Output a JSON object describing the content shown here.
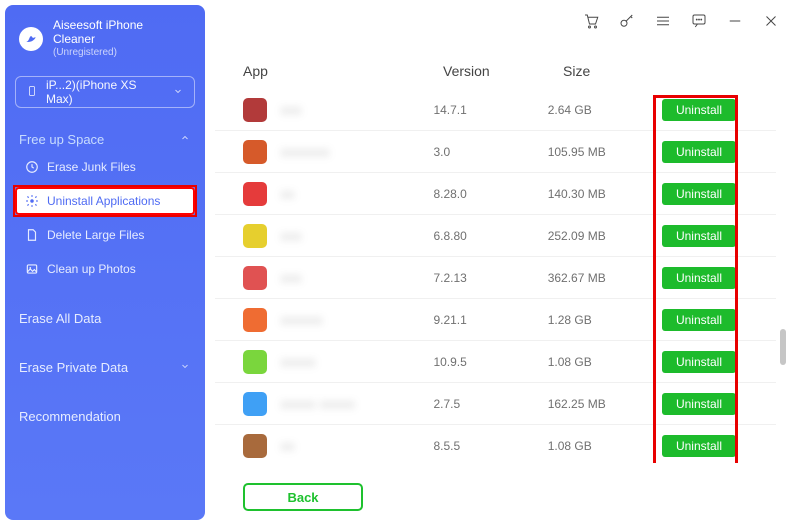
{
  "brand": {
    "name": "Aiseesoft iPhone",
    "sub": "Cleaner",
    "status": "(Unregistered)"
  },
  "device": {
    "label": "iP...2)(iPhone XS Max)"
  },
  "sidebar": {
    "free_up_space": "Free up Space",
    "items": [
      {
        "label": "Erase Junk Files"
      },
      {
        "label": "Uninstall Applications"
      },
      {
        "label": "Delete Large Files"
      },
      {
        "label": "Clean up Photos"
      }
    ],
    "erase_all": "Erase All Data",
    "erase_private": "Erase Private Data",
    "recommendation": "Recommendation"
  },
  "columns": {
    "app": "App",
    "version": "Version",
    "size": "Size"
  },
  "actions": {
    "uninstall": "Uninstall",
    "back": "Back"
  },
  "apps": [
    {
      "version": "14.7.1",
      "size": "2.64 GB"
    },
    {
      "version": "3.0",
      "size": "105.95 MB"
    },
    {
      "version": "8.28.0",
      "size": "140.30 MB"
    },
    {
      "version": "6.8.80",
      "size": "252.09 MB"
    },
    {
      "version": "7.2.13",
      "size": "362.67 MB"
    },
    {
      "version": "9.21.1",
      "size": "1.28 GB"
    },
    {
      "version": "10.9.5",
      "size": "1.08 GB"
    },
    {
      "version": "2.7.5",
      "size": "162.25 MB"
    },
    {
      "version": "8.5.5",
      "size": "1.08 GB"
    }
  ]
}
